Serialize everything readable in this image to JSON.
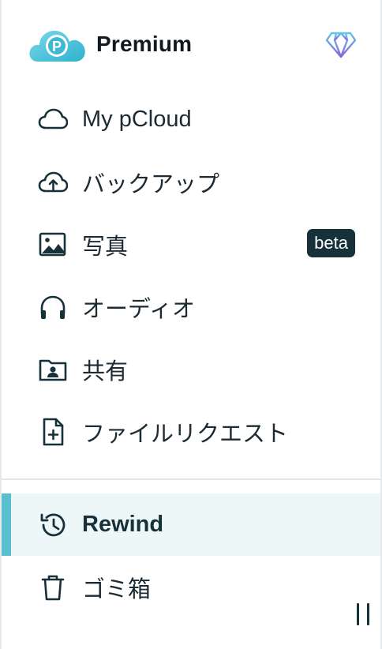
{
  "brand": {
    "title": "Premium",
    "logo_letter": "P",
    "logo_icon": "pcloud-logo-icon",
    "plan_icon": "diamond-icon",
    "colors": {
      "cloud_light": "#66d0e3",
      "cloud_dark": "#2bb3cf",
      "diamond_top": "#5ec8e6",
      "diamond_bottom": "#8a63d8"
    }
  },
  "nav": {
    "items": [
      {
        "label": "My pCloud",
        "icon": "cloud-icon"
      },
      {
        "label": "バックアップ",
        "icon": "cloud-upload-icon"
      },
      {
        "label": "写真",
        "icon": "image-icon",
        "badge": "beta"
      },
      {
        "label": "オーディオ",
        "icon": "headphones-icon"
      },
      {
        "label": "共有",
        "icon": "shared-folder-icon"
      },
      {
        "label": "ファイルリクエスト",
        "icon": "file-request-icon"
      }
    ],
    "secondary": [
      {
        "label": "Rewind",
        "icon": "history-icon",
        "active": true
      },
      {
        "label": "ゴミ箱",
        "icon": "trash-icon"
      }
    ]
  },
  "accent_color": "#58c0cc",
  "active_bg": "#eef7f8",
  "text_color": "#17313b"
}
